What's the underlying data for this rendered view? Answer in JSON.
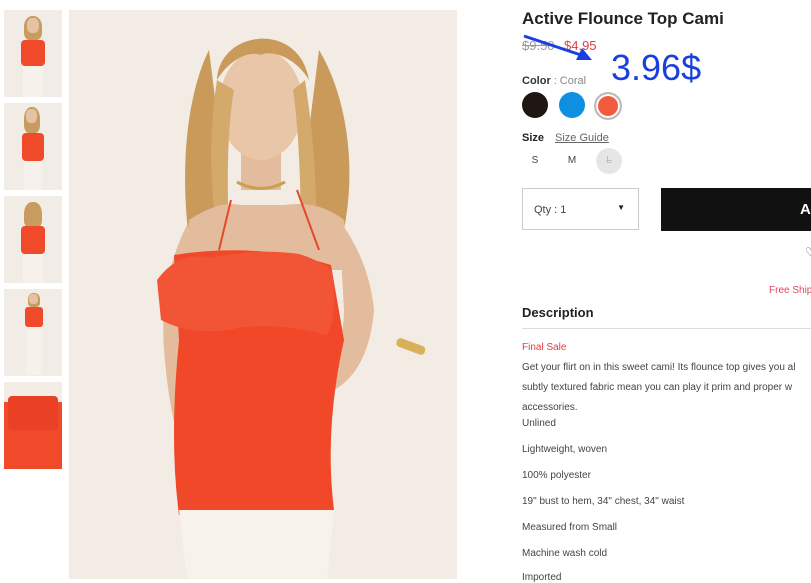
{
  "product": {
    "title": "Active Flounce Top Cami",
    "old_price": "$9.50",
    "sale_price": "$4.95",
    "annotation_price": "3.96$",
    "color_label": "Color",
    "color_value": "Coral",
    "colors": [
      {
        "name": "black",
        "hex": "#1d1612"
      },
      {
        "name": "blue",
        "hex": "#0e8fe0"
      },
      {
        "name": "coral",
        "hex": "#f25a40"
      }
    ],
    "size_label": "Size",
    "size_guide": "Size Guide",
    "sizes": [
      "S",
      "M",
      "L"
    ],
    "qty_label": "Qty : 1",
    "add_button": "A",
    "free_shipping": "Free Shipp",
    "description_heading": "Description",
    "final_sale": "Final Sale",
    "description_lines": [
      "Get your flirt on in this sweet cami! Its flounce top gives you al",
      "subtly textured fabric mean you can play it prim and proper w",
      "accessories."
    ],
    "specs": [
      "Unlined",
      "Lightweight, woven",
      "100% polyester",
      "19\" bust to hem, 34\" chest, 34\" waist",
      "Measured from Small",
      "Machine wash cold",
      "Imported"
    ]
  },
  "colors": {
    "accent_sale": "#e43a3a",
    "annotation": "#1a3fe0",
    "button": "#111111"
  }
}
